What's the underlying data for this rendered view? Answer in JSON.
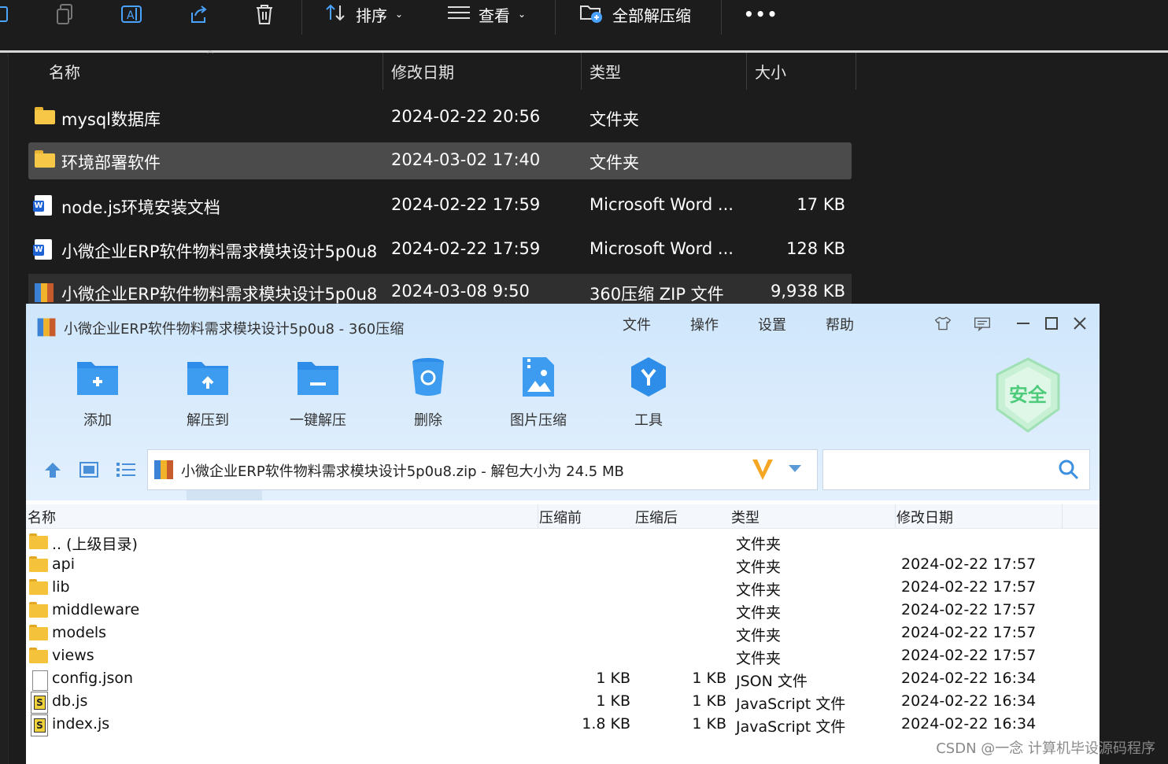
{
  "explorer": {
    "toolbar": {
      "sort_label": "排序",
      "view_label": "查看",
      "extract_all_label": "全部解压缩",
      "more_label": "•••"
    },
    "columns": {
      "name": "名称",
      "date": "修改日期",
      "type": "类型",
      "size": "大小"
    },
    "rows": [
      {
        "name": "mysql数据库",
        "date": "2024-02-22 20:56",
        "type": "文件夹",
        "size": "",
        "icon": "folder-icon"
      },
      {
        "name": "环境部署软件",
        "date": "2024-03-02 17:40",
        "type": "文件夹",
        "size": "",
        "icon": "folder-icon"
      },
      {
        "name": "node.js环境安装文档",
        "date": "2024-02-22 17:59",
        "type": "Microsoft Word ...",
        "size": "17 KB",
        "icon": "word-doc-icon"
      },
      {
        "name": "小微企业ERP软件物料需求模块设计5p0u8",
        "date": "2024-02-22 17:59",
        "type": "Microsoft Word ...",
        "size": "128 KB",
        "icon": "word-doc-icon"
      },
      {
        "name": "小微企业ERP软件物料需求模块设计5p0u8",
        "date": "2024-03-08 9:50",
        "type": "360压缩 ZIP 文件",
        "size": "9,938 KB",
        "icon": "zip-archive-icon"
      }
    ]
  },
  "zip_window": {
    "title": "小微企业ERP软件物料需求模块设计5p0u8 - 360压缩",
    "menu": [
      "文件",
      "操作",
      "设置",
      "帮助"
    ],
    "buttons": {
      "add": "添加",
      "extract_to": "解压到",
      "one_click_extract": "一键解压",
      "delete": "删除",
      "image_compress": "图片压缩",
      "tools": "工具"
    },
    "security_badge": "安全",
    "address_text": "小微企业ERP软件物料需求模块设计5p0u8.zip - 解包大小为 24.5 MB",
    "search_placeholder": "",
    "columns": {
      "name": "名称",
      "before": "压缩前",
      "after": "压缩后",
      "type": "类型",
      "date": "修改日期"
    },
    "rows": [
      {
        "name": ".. (上级目录)",
        "before": "",
        "after": "",
        "type": "文件夹",
        "date": "",
        "icon": "folder-icon"
      },
      {
        "name": "api",
        "before": "",
        "after": "",
        "type": "文件夹",
        "date": "2024-02-22 17:57",
        "icon": "folder-icon"
      },
      {
        "name": "lib",
        "before": "",
        "after": "",
        "type": "文件夹",
        "date": "2024-02-22 17:57",
        "icon": "folder-icon"
      },
      {
        "name": "middleware",
        "before": "",
        "after": "",
        "type": "文件夹",
        "date": "2024-02-22 17:57",
        "icon": "folder-icon"
      },
      {
        "name": "models",
        "before": "",
        "after": "",
        "type": "文件夹",
        "date": "2024-02-22 17:57",
        "icon": "folder-icon"
      },
      {
        "name": "views",
        "before": "",
        "after": "",
        "type": "文件夹",
        "date": "2024-02-22 17:57",
        "icon": "folder-icon"
      },
      {
        "name": "config.json",
        "before": "1 KB",
        "after": "1 KB",
        "type": "JSON 文件",
        "date": "2024-02-22 16:34",
        "icon": "json-file-icon"
      },
      {
        "name": "db.js",
        "before": "1 KB",
        "after": "1 KB",
        "type": "JavaScript 文件",
        "date": "2024-02-22 16:34",
        "icon": "js-file-icon"
      },
      {
        "name": "index.js",
        "before": "1.8 KB",
        "after": "1 KB",
        "type": "JavaScript 文件",
        "date": "2024-02-22 16:34",
        "icon": "js-file-icon"
      }
    ]
  },
  "watermark": "CSDN @一念 计算机毕设源码程序"
}
